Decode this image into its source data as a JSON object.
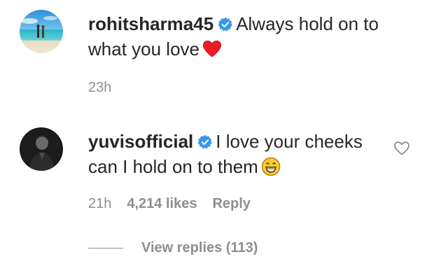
{
  "comments": [
    {
      "username": "rohitsharma45",
      "verified": true,
      "text_line1": "Always hold on to",
      "text_line2": "what you love",
      "emoji": "red-heart",
      "time": "23h"
    },
    {
      "username": "yuvisofficial",
      "verified": true,
      "text_line1": "I love your cheeks",
      "text_line2": "can I hold on to them",
      "emoji": "grinning-face-with-smiling-eyes",
      "time": "21h",
      "likes": "4,214 likes",
      "reply_label": "Reply",
      "view_replies": "View replies (113)"
    }
  ],
  "colors": {
    "text": "#262626",
    "muted": "#8e8e8e",
    "verified": "#3897f0",
    "heart": "#ed1c24"
  }
}
